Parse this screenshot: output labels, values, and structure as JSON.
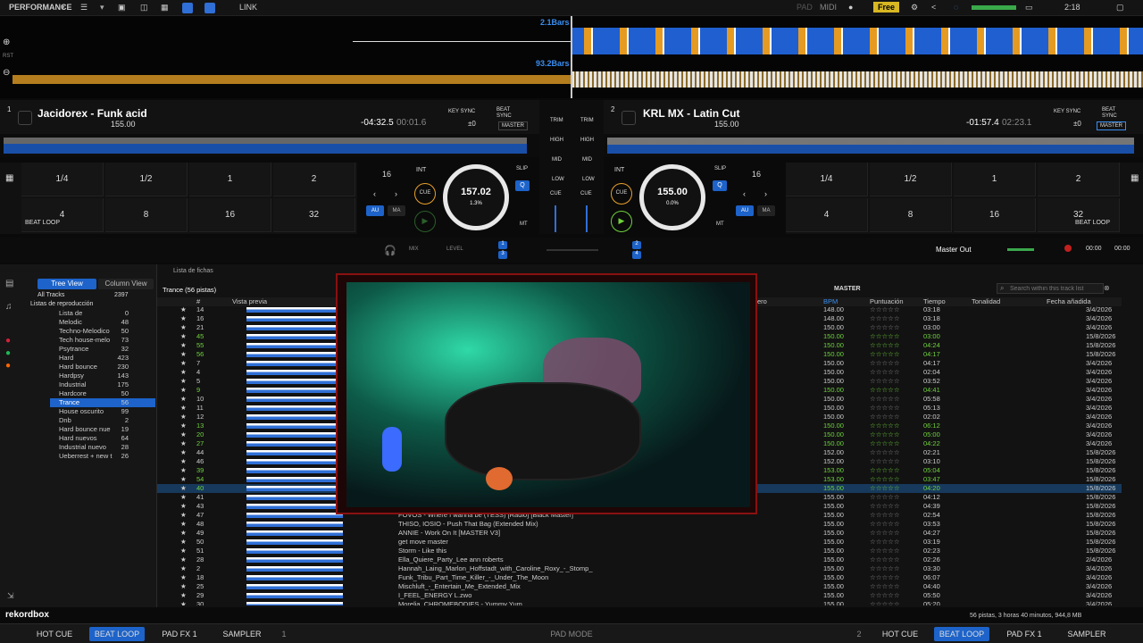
{
  "topbar": {
    "mode": "PERFORMANCE",
    "link": "LINK",
    "pad": "PAD",
    "midi": "MIDI",
    "plan": "Free",
    "time": "2:18"
  },
  "waveform": {
    "bars_top": "2.1Bars",
    "bars_bottom": "93.2Bars",
    "rst": "RST"
  },
  "deck1": {
    "num": "1",
    "title": "Jacidorex - Funk acid",
    "bpm": "155.00",
    "remain": "-04:32.5",
    "elapsed": "00:01.6",
    "keysync": "KEY SYNC",
    "beatsync": "BEAT SYNC",
    "key_offset": "±0",
    "master": "MASTER",
    "loop_beats": "16",
    "int": "INT",
    "cue": "CUE",
    "bpm_big": "157.02",
    "pitch": "1.3%",
    "slip": "SLIP",
    "q": "Q",
    "au": "AU",
    "ma": "MA",
    "mt": "MT",
    "beatloop": "BEAT LOOP",
    "pads": [
      "1/4",
      "1/2",
      "1",
      "2",
      "4",
      "8",
      "16",
      "32"
    ]
  },
  "deck2": {
    "num": "2",
    "title": "KRL MX - Latin Cut",
    "bpm": "155.00",
    "remain": "-01:57.4",
    "elapsed": "02:23.1",
    "keysync": "KEY SYNC",
    "beatsync": "BEAT SYNC",
    "key_offset": "±0",
    "master": "MASTER",
    "loop_beats": "16",
    "int": "INT",
    "cue": "CUE",
    "bpm_big": "155.00",
    "pitch": "0.0%",
    "slip": "SLIP",
    "q": "Q",
    "au": "AU",
    "ma": "MA",
    "mt": "MT",
    "beatloop": "BEAT LOOP",
    "pads": [
      "1/4",
      "1/2",
      "1",
      "2",
      "4",
      "8",
      "16",
      "32"
    ]
  },
  "mixer": {
    "trim": "TRIM",
    "high": "HIGH",
    "mid": "MID",
    "low": "LOW",
    "cue": "CUE",
    "mix": "MIX",
    "level": "LEVEL",
    "master_out": "Master Out",
    "rec_time": "00:00",
    "rec_extra": "00:00"
  },
  "browser": {
    "tree_view": "Tree View",
    "column_view": "Column View",
    "all_tracks": "All Tracks",
    "all_count": "2397",
    "playlists": "Listas de reproducción",
    "list_title": "Lista de fichas",
    "current_list": "Trance (56 pistas)",
    "search_placeholder": "Search within this track list",
    "master_label": "MASTER",
    "tree": [
      [
        "Lista de",
        "0"
      ],
      [
        "Melodic",
        "48"
      ],
      [
        "Techno-Melodico",
        "50"
      ],
      [
        "Tech house-melo",
        "73"
      ],
      [
        "Psytrance",
        "32"
      ],
      [
        "Hard",
        "423"
      ],
      [
        "Hard bounce",
        "230"
      ],
      [
        "Hardpsy",
        "143"
      ],
      [
        "Industrial",
        "175"
      ],
      [
        "Hardcore",
        "50"
      ],
      [
        "Trance",
        "56"
      ],
      [
        "House oscurito",
        "99"
      ],
      [
        "Dnb",
        "2"
      ],
      [
        "Hard bounce nue",
        "19"
      ],
      [
        "Hard nuevos",
        "64"
      ],
      [
        "Industrial nuevo",
        "28"
      ],
      [
        "Ueberrest + new t",
        "26"
      ]
    ],
    "columns": {
      "num": "#",
      "preview": "Vista previa",
      "genre": "ero",
      "bpm": "BPM",
      "rating": "Puntuación",
      "time": "Tiempo",
      "key": "Tonalidad",
      "added": "Fecha añadida"
    },
    "rows": [
      [
        "14",
        "",
        "148.00",
        "03:18",
        "3/4/2026"
      ],
      [
        "16",
        "",
        "148.00",
        "03:18",
        "3/4/2026"
      ],
      [
        "21",
        "",
        "150.00",
        "03:00",
        "3/4/2026"
      ],
      [
        "45",
        "",
        "150.00",
        "03:00",
        "15/8/2026"
      ],
      [
        "55",
        "",
        "150.00",
        "04:24",
        "15/8/2026"
      ],
      [
        "56",
        "",
        "150.00",
        "04:17",
        "15/8/2026"
      ],
      [
        "7",
        "",
        "150.00",
        "04:17",
        "3/4/2026"
      ],
      [
        "4",
        "",
        "150.00",
        "02:04",
        "3/4/2026"
      ],
      [
        "5",
        "",
        "150.00",
        "03:52",
        "3/4/2026"
      ],
      [
        "9",
        "",
        "150.00",
        "04:41",
        "3/4/2026"
      ],
      [
        "10",
        "",
        "150.00",
        "05:58",
        "3/4/2026"
      ],
      [
        "11",
        "",
        "150.00",
        "05:13",
        "3/4/2026"
      ],
      [
        "12",
        "",
        "150.00",
        "02:02",
        "3/4/2026"
      ],
      [
        "13",
        "",
        "150.00",
        "06:12",
        "3/4/2026"
      ],
      [
        "20",
        "",
        "150.00",
        "05:00",
        "3/4/2026"
      ],
      [
        "27",
        "",
        "150.00",
        "04:22",
        "3/4/2026"
      ],
      [
        "44",
        "",
        "152.00",
        "02:21",
        "15/8/2026"
      ],
      [
        "46",
        "",
        "152.00",
        "03:10",
        "15/8/2026"
      ],
      [
        "39",
        "",
        "153.00",
        "05:04",
        "15/8/2026"
      ],
      [
        "54",
        "",
        "153.00",
        "03:47",
        "15/8/2026"
      ],
      [
        "40",
        "",
        "155.00",
        "04:20",
        "15/8/2026"
      ],
      [
        "41",
        "",
        "155.00",
        "04:12",
        "15/8/2026"
      ],
      [
        "43",
        "",
        "155.00",
        "04:39",
        "15/8/2026"
      ],
      [
        "47",
        "FOVOS - Where I wanna be (TESS) [Radio] [Black Master]",
        "155.00",
        "02:54",
        "15/8/2026"
      ],
      [
        "48",
        "THISO, IOSIO - Push That Bag (Extended Mix)",
        "155.00",
        "03:53",
        "15/8/2026"
      ],
      [
        "49",
        "ANNIE - Work On It [MASTER V3]",
        "155.00",
        "04:27",
        "15/8/2026"
      ],
      [
        "50",
        "get move master",
        "155.00",
        "03:19",
        "15/8/2026"
      ],
      [
        "51",
        "Storm - Like this",
        "155.00",
        "02:23",
        "15/8/2026"
      ],
      [
        "28",
        "Ella_Quiere_Party_Lee ann roberts",
        "155.00",
        "02:26",
        "2/4/2026"
      ],
      [
        "2",
        "Hannah_Laing_Marlon_Hoffstadt_with_Caroline_Roxy_-_Stomp_",
        "155.00",
        "03:30",
        "3/4/2026"
      ],
      [
        "18",
        "Funk_Tribu_Part_Time_Killer_-_Under_The_Moon",
        "155.00",
        "06:07",
        "3/4/2026"
      ],
      [
        "25",
        "Mischluft_-_Entertain_Me_Extended_Mix",
        "155.00",
        "04:40",
        "3/4/2026"
      ],
      [
        "29",
        "I_FEEL_ENERGY L.zwo",
        "155.00",
        "05:50",
        "3/4/2026"
      ],
      [
        "30",
        "Morelia_CHROMEBODIES - Yummy Yum",
        "155.00",
        "05:20",
        "3/4/2026"
      ]
    ],
    "footer": "56 pistas, 3 horas 40 minutos, 944,8 MB"
  },
  "bottombar": {
    "hotcue": "HOT CUE",
    "beatloop": "BEAT LOOP",
    "padfx": "PAD FX 1",
    "sampler": "SAMPLER",
    "deck_left": "1",
    "pad_mode": "PAD MODE",
    "deck_right": "2"
  },
  "brand": "rekordbox",
  "colors": {
    "accent": "#1d63c9",
    "green": "#6fd23c",
    "orange": "#e9a12a"
  }
}
